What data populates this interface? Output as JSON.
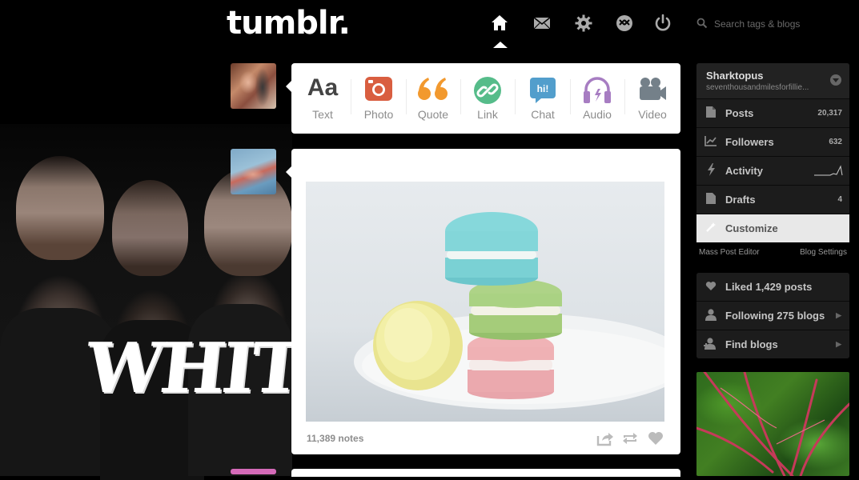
{
  "header": {
    "logo": "tumblr.",
    "nav": [
      {
        "name": "home-icon",
        "active": true
      },
      {
        "name": "mail-icon"
      },
      {
        "name": "gear-icon"
      },
      {
        "name": "xkit-icon"
      },
      {
        "name": "power-icon"
      }
    ],
    "search_placeholder": "Search tags & blogs"
  },
  "composer": {
    "types": [
      {
        "label": "Text",
        "icon": "text-icon",
        "glyph": "Aa",
        "color": "#444444"
      },
      {
        "label": "Photo",
        "icon": "camera-icon",
        "color": "#d95e40"
      },
      {
        "label": "Quote",
        "icon": "quote-icon",
        "glyph": "❝",
        "color": "#f2992e"
      },
      {
        "label": "Link",
        "icon": "link-icon",
        "color": "#56bc8a"
      },
      {
        "label": "Chat",
        "icon": "chat-icon",
        "glyph": "hi!",
        "color": "#529ecc"
      },
      {
        "label": "Audio",
        "icon": "headphones-icon",
        "color": "#a77dc2"
      },
      {
        "label": "Video",
        "icon": "video-icon",
        "color": "#748089"
      }
    ]
  },
  "post": {
    "notes": "11,389 notes",
    "actions": [
      "share-icon",
      "reblog-icon",
      "like-icon"
    ]
  },
  "sidebar": {
    "blog_name": "Sharktopus",
    "blog_url": "seventhousandmilesforfillie...",
    "rows": [
      {
        "label": "Posts",
        "count": "20,317",
        "icon": "document-icon"
      },
      {
        "label": "Followers",
        "count": "632",
        "icon": "chart-icon"
      },
      {
        "label": "Activity",
        "count": "",
        "icon": "lightning-icon"
      },
      {
        "label": "Drafts",
        "count": "4",
        "icon": "draft-icon"
      },
      {
        "label": "Customize",
        "count": "",
        "icon": "wand-icon"
      }
    ],
    "links": {
      "left": "Mass Post Editor",
      "right": "Blog Settings"
    },
    "secondary": [
      {
        "label": "Liked 1,429 posts",
        "icon": "heart-icon"
      },
      {
        "label": "Following 275 blogs",
        "icon": "person-icon"
      },
      {
        "label": "Find blogs",
        "icon": "add-person-icon"
      }
    ]
  }
}
